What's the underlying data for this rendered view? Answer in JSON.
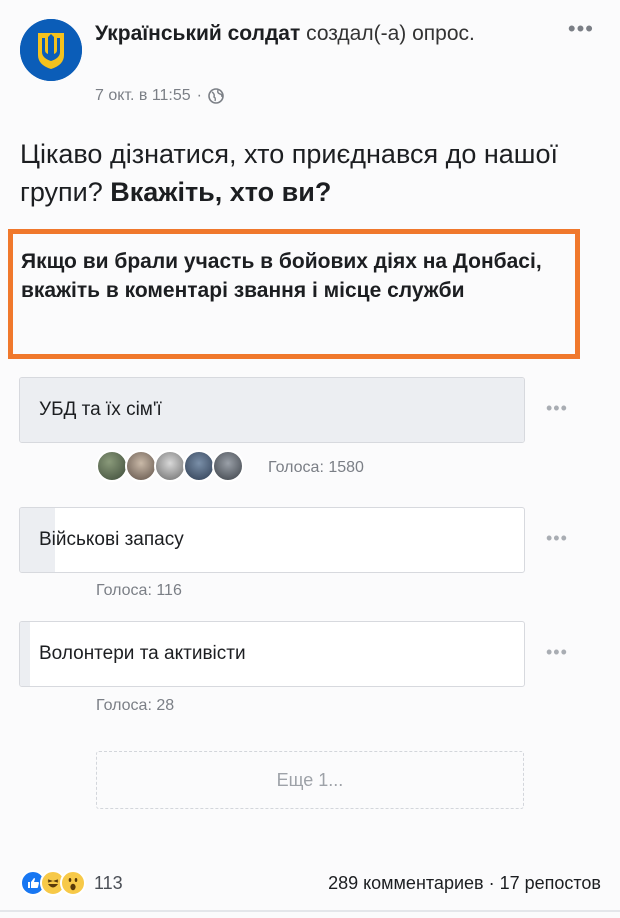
{
  "post": {
    "author": "Український солдат",
    "action": " создал(-а) опрос.",
    "timestamp": "7 окт. в 11:55",
    "separator": "·",
    "privacy_icon": "globe-icon",
    "more_label": "•••"
  },
  "question": {
    "text_regular": "Цікаво дізнатися, хто приєднався до нашої групи? ",
    "text_bold": "Вкажіть, хто ви?"
  },
  "highlight": {
    "text": "Якщо ви брали участь в бойових діях на Донбасі, вкажіть в коментарі звання і місце служби",
    "border_color": "#f0782c"
  },
  "poll": {
    "options": [
      {
        "label": "УБД та їх сім'ї",
        "votes_text": "Голоса: 1580",
        "votes": 1580,
        "fill_fraction": 1.0,
        "more_label": "•••"
      },
      {
        "label": "Військові запасу",
        "votes_text": "Голоса: 116",
        "votes": 116,
        "fill_fraction": 0.07,
        "more_label": "•••"
      },
      {
        "label": "Волонтери та активісти",
        "votes_text": "Голоса: 28",
        "votes": 28,
        "fill_fraction": 0.02,
        "more_label": "•••"
      }
    ],
    "more_button": "Еще 1..."
  },
  "footer": {
    "reaction_icons": [
      "like-icon",
      "haha-icon",
      "wow-icon"
    ],
    "reactions_count": "113",
    "stats": "289 комментариев · 17 репостов"
  },
  "colors": {
    "accent": "#1877f2",
    "poll_fill": "#eceef2",
    "muted": "#7b7f86"
  }
}
